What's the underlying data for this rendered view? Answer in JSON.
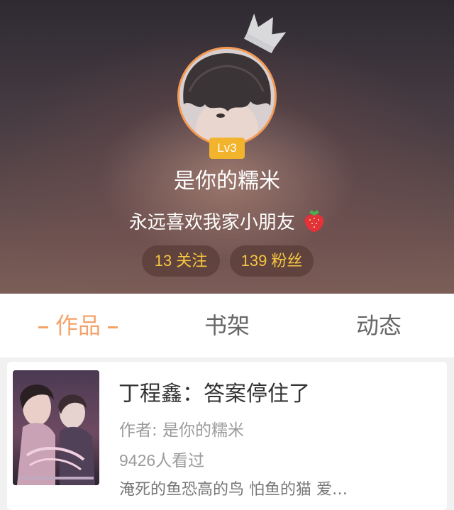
{
  "profile": {
    "level": "Lv3",
    "nickname": "是你的糯米",
    "signature": "永远喜欢我家小朋友",
    "follow_count": "13",
    "follow_label": "关注",
    "fans_count": "139",
    "fans_label": "粉丝"
  },
  "tabs": [
    {
      "label": "作品",
      "active": true
    },
    {
      "label": "书架",
      "active": false
    },
    {
      "label": "动态",
      "active": false
    }
  ],
  "works": [
    {
      "title": "丁程鑫：答案停住了",
      "author": "作者: 是你的糯米",
      "views_count": "9426",
      "views_suffix": "人看过",
      "description": "淹死的鱼恐高的鸟 怕鱼的猫 爱…"
    }
  ],
  "icons": {
    "crown": "crown-icon",
    "strawberry": "strawberry-icon"
  },
  "colors": {
    "accent_orange": "#f5a26a",
    "badge_gold": "#f2b32d",
    "pill_text": "#f6c640",
    "avatar_ring": "#f39a55"
  }
}
